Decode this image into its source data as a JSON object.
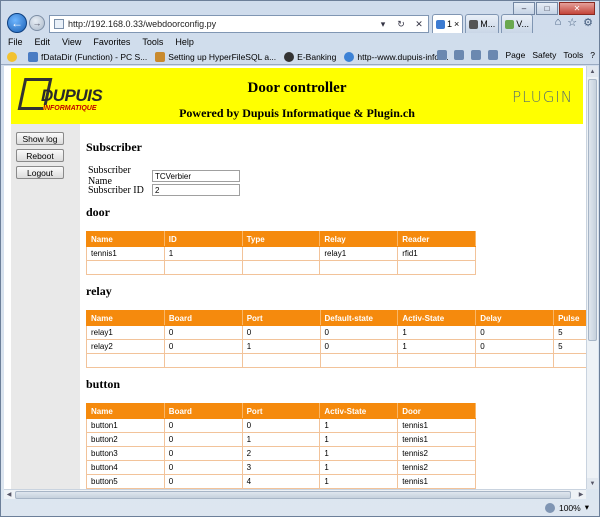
{
  "browser": {
    "url": "http://192.168.0.33/webdoorconfig.py",
    "tabs": [
      "1",
      "M...",
      "V..."
    ],
    "menu": [
      "File",
      "Edit",
      "View",
      "Favorites",
      "Tools",
      "Help"
    ],
    "favorites": [
      "fDataDir (Function) - PC S...",
      "Setting up HyperFileSQL a...",
      "E-Banking",
      "http--www.dupuis-infor..."
    ],
    "commands": [
      "Page",
      "Safety",
      "Tools"
    ],
    "zoom": "100%"
  },
  "banner": {
    "logo_brand": "DUPUIS",
    "logo_sub": "INFORMATIQUE",
    "title": "Door controller",
    "subtitle": "Powered by Dupuis Informatique & Plugin.ch",
    "partner_logo": "PLUGIN"
  },
  "sidebar": {
    "show_log": "Show log",
    "reboot": "Reboot",
    "logout": "Logout"
  },
  "subscriber": {
    "heading": "Subscriber",
    "name_label": "Subscriber Name",
    "name_value": "TCVerbier",
    "id_label": "Subscriber ID",
    "id_value": "2"
  },
  "door": {
    "heading": "door",
    "columns": [
      "Name",
      "ID",
      "Type",
      "Relay",
      "Reader"
    ],
    "rows": [
      [
        "tennis1",
        "1",
        "",
        "relay1",
        "rfid1"
      ],
      [
        "",
        "",
        "",
        "",
        ""
      ]
    ]
  },
  "relay": {
    "heading": "relay",
    "columns": [
      "Name",
      "Board",
      "Port",
      "Default-state",
      "Activ-State",
      "Delay",
      "Pulse"
    ],
    "rows": [
      [
        "relay1",
        "0",
        "0",
        "0",
        "1",
        "0",
        "5"
      ],
      [
        "relay2",
        "0",
        "1",
        "0",
        "1",
        "0",
        "5"
      ],
      [
        "",
        "",
        "",
        "",
        "",
        "",
        ""
      ]
    ]
  },
  "button": {
    "heading": "button",
    "columns": [
      "Name",
      "Board",
      "Port",
      "Activ-State",
      "Door"
    ],
    "rows": [
      [
        "button1",
        "0",
        "0",
        "1",
        "tennis1"
      ],
      [
        "button2",
        "0",
        "1",
        "1",
        "tennis1"
      ],
      [
        "button3",
        "0",
        "2",
        "1",
        "tennis2"
      ],
      [
        "button4",
        "0",
        "3",
        "1",
        "tennis2"
      ],
      [
        "button5",
        "0",
        "4",
        "1",
        "tennis1"
      ]
    ]
  },
  "colors": {
    "banner": "#ffff00",
    "table_header": "#f58a0d",
    "sidebar": "#e9e9e9"
  }
}
